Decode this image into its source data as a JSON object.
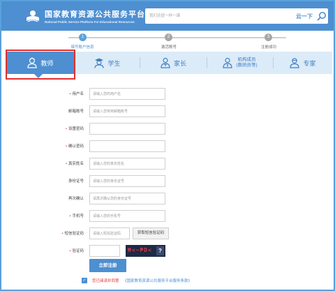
{
  "header": {
    "title": "国家教育资源公共服务平台",
    "subtitle": "National Public Service Platform For Educational Resources",
    "search_placeholder": "我们还提一样一课",
    "search_brand": "云一下"
  },
  "steps": [
    {
      "number": "1",
      "label": "填写账户信息",
      "active": true
    },
    {
      "number": "2",
      "label": "激活账号",
      "active": false
    },
    {
      "number": "3",
      "label": "注册成功",
      "active": false
    }
  ],
  "tabs": [
    {
      "label": "教师",
      "icon": "teacher-icon",
      "active": true
    },
    {
      "label": "学生",
      "icon": "student-icon",
      "active": false
    },
    {
      "label": "家长",
      "icon": "parent-icon",
      "active": false
    },
    {
      "label": "机构成员",
      "sublabel": "(教研员等)",
      "icon": "institution-member-icon",
      "active": false
    },
    {
      "label": "专家",
      "icon": "expert-icon",
      "active": false
    }
  ],
  "form": {
    "fields": [
      {
        "label": "用户名",
        "required": true,
        "placeholder": "请输入您的用户名"
      },
      {
        "label": "邮箱账号",
        "required": false,
        "placeholder": "请输入您常用邮箱账号"
      },
      {
        "label": "设置密码",
        "required": true,
        "placeholder": ""
      },
      {
        "label": "确认密码",
        "required": true,
        "placeholder": ""
      },
      {
        "label": "真实姓名",
        "required": true,
        "placeholder": "请输入您的真实姓名"
      },
      {
        "label": "身份证号",
        "required": false,
        "placeholder": "请输入您的身份证号"
      },
      {
        "label": "再次确认",
        "required": false,
        "placeholder": "请再次确认您的身份证号"
      },
      {
        "label": "手机号",
        "required": true,
        "placeholder": "请输入您的手机号"
      }
    ],
    "sms": {
      "label": "短信验证码",
      "required": true,
      "placeholder": "请输入短信验证码",
      "button_label": "获取短信验证码"
    },
    "captcha": {
      "label": "验证码",
      "required": true,
      "image_text": "₩<~₱D<",
      "refresh": "?"
    },
    "submit_label": "立即注册",
    "agree_text": "您已阅读并同意",
    "agree_link": "《国家教育资源公共服务平台服务条款》",
    "agree_checked": true
  },
  "colors": {
    "brand": "#4d8fd1",
    "tab_bg": "#dcebf8",
    "required": "#e0302f",
    "highlight_outline": "#e0302f"
  }
}
